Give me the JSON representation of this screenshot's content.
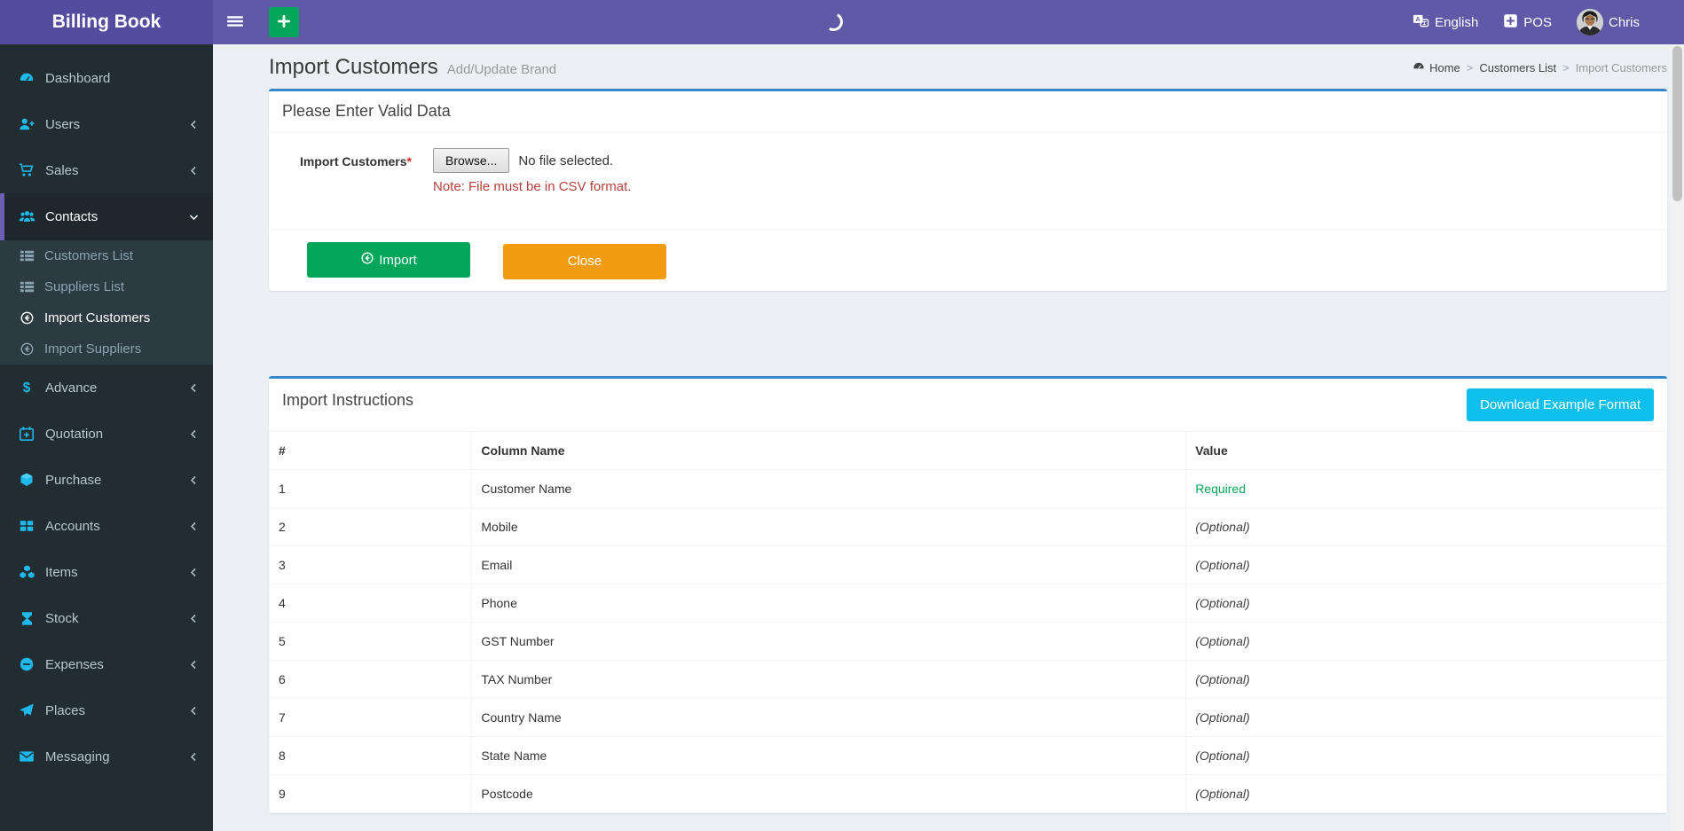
{
  "app": {
    "title": "Billing Book"
  },
  "topbar": {
    "language": "English",
    "pos": "POS",
    "user": "Chris"
  },
  "sidebar": {
    "items": [
      {
        "label": "Dashboard"
      },
      {
        "label": "Users"
      },
      {
        "label": "Sales"
      },
      {
        "label": "Contacts"
      },
      {
        "label": "Advance"
      },
      {
        "label": "Quotation"
      },
      {
        "label": "Purchase"
      },
      {
        "label": "Accounts"
      },
      {
        "label": "Items"
      },
      {
        "label": "Stock"
      },
      {
        "label": "Expenses"
      },
      {
        "label": "Places"
      },
      {
        "label": "Messaging"
      }
    ],
    "submenu": [
      {
        "label": "Customers List"
      },
      {
        "label": "Suppliers List"
      },
      {
        "label": "Import Customers"
      },
      {
        "label": "Import Suppliers"
      }
    ]
  },
  "page": {
    "title": "Import Customers",
    "subtitle": "Add/Update Brand",
    "breadcrumb": {
      "home": "Home",
      "level1": "Customers List",
      "current": "Import Customers",
      "sep": ">"
    }
  },
  "form_box": {
    "header": "Please Enter Valid Data",
    "label": "Import Customers",
    "required_mark": "*",
    "browse_label": "Browse...",
    "file_status": "No file selected.",
    "note": "Note: File must be in CSV format.",
    "import_button": "Import",
    "close_button": "Close"
  },
  "instructions_box": {
    "header": "Import Instructions",
    "download_button": "Download Example Format",
    "table": {
      "headers": [
        "#",
        "Column Name",
        "Value"
      ],
      "rows": [
        {
          "num": "1",
          "column": "Customer Name",
          "value": "Required"
        },
        {
          "num": "2",
          "column": "Mobile",
          "value": "(Optional)"
        },
        {
          "num": "3",
          "column": "Email",
          "value": "(Optional)"
        },
        {
          "num": "4",
          "column": "Phone",
          "value": "(Optional)"
        },
        {
          "num": "5",
          "column": "GST Number",
          "value": "(Optional)"
        },
        {
          "num": "6",
          "column": "TAX Number",
          "value": "(Optional)"
        },
        {
          "num": "7",
          "column": "Country Name",
          "value": "(Optional)"
        },
        {
          "num": "8",
          "column": "State Name",
          "value": "(Optional)"
        },
        {
          "num": "9",
          "column": "Postcode",
          "value": "(Optional)"
        }
      ]
    }
  },
  "colors": {
    "navbar_purple": "#6059A8",
    "logo_purple": "#544C9E",
    "sidebar_dark": "#222d32",
    "submenu_dark": "#2c3b41",
    "active_border_purple": "#6a5fb0",
    "icon_cyan": "#1eb8ea",
    "box_top_blue": "#3788c8",
    "green": "#00a65a",
    "orange": "#f39c12",
    "cyan_button": "#0FC0EF",
    "required_green": "#00a65a",
    "note_red": "#B4403C"
  }
}
